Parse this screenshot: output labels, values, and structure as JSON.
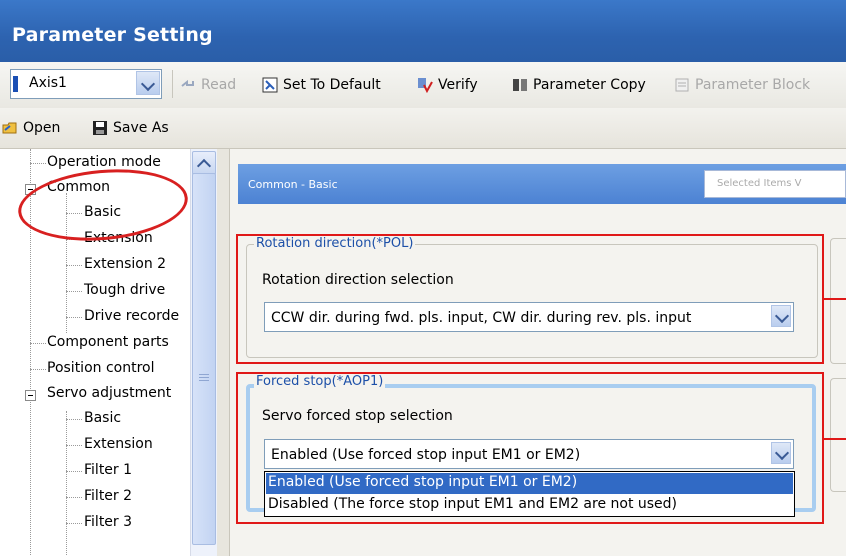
{
  "window": {
    "title": "Parameter Setting"
  },
  "toolbar": {
    "axis_value": "Axis1",
    "read": "Read",
    "set_default": "Set To Default",
    "verify": "Verify",
    "parameter_copy": "Parameter Copy",
    "parameter_block": "Parameter Block",
    "open": "Open",
    "save_as": "Save As"
  },
  "tree": {
    "items": [
      "Operation mode",
      "Common",
      "Basic",
      "Extension",
      "Extension 2",
      "Tough drive",
      "Drive recorde",
      "Component parts",
      "Position control",
      "Servo adjustment",
      "Basic",
      "Extension",
      "Filter 1",
      "Filter 2",
      "Filter 3"
    ]
  },
  "section": {
    "title": "Common - Basic",
    "selected_items_placeholder": "Selected Items V"
  },
  "rotation": {
    "group_title": "Rotation direction(*POL)",
    "label": "Rotation direction selection",
    "value": "CCW dir. during fwd. pls. input, CW dir. during rev. pls. input"
  },
  "forced_stop": {
    "group_title": "Forced stop(*AOP1)",
    "label": "Servo forced stop selection",
    "value": "Enabled (Use forced stop input EM1 or EM2)",
    "options": [
      "Enabled (Use forced stop input EM1 or EM2)",
      "Disabled (The force stop input EM1 and EM2 are not used)"
    ]
  },
  "colors": {
    "title_bar": "#2d63b0",
    "section_header": "#5a8fdb",
    "annotation_red": "#e01818",
    "selection": "#316ac5",
    "group_title_text": "#1d50a8"
  },
  "icons": [
    "axis-icon",
    "read-icon",
    "set-default-icon",
    "verify-icon",
    "parameter-copy-icon",
    "parameter-block-icon",
    "open-folder-icon",
    "save-icon"
  ]
}
